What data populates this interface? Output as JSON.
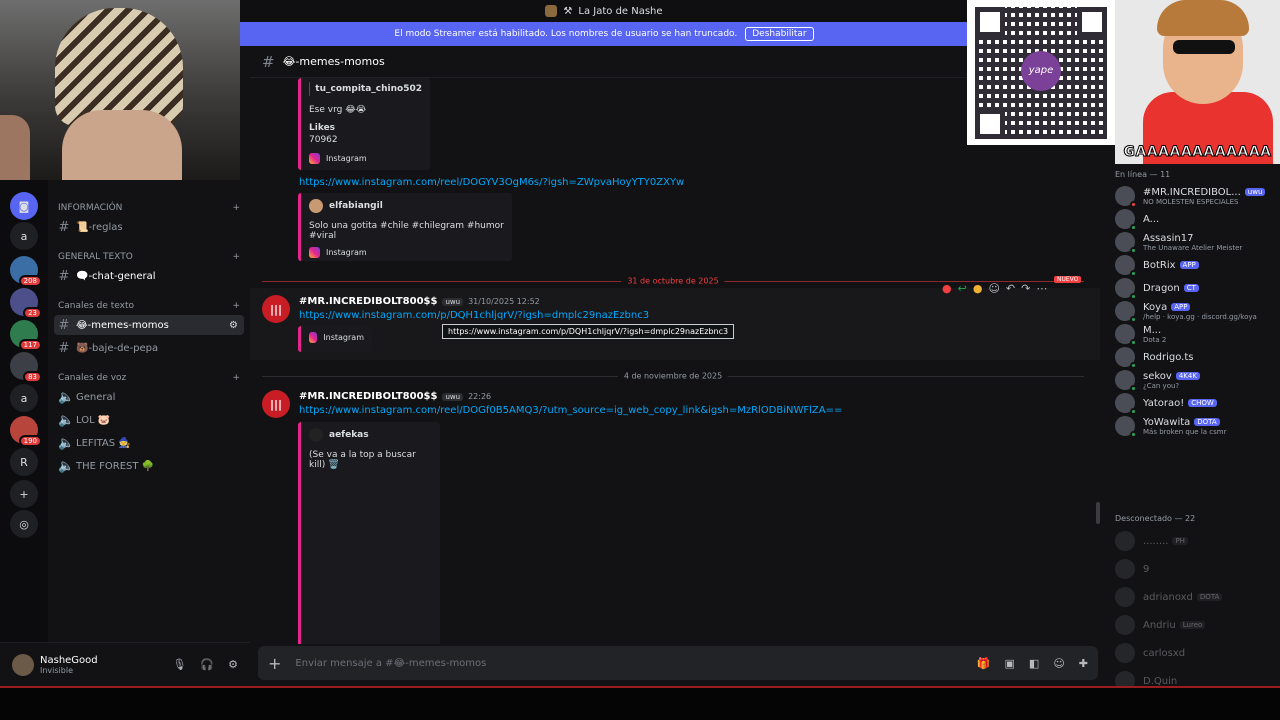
{
  "window": {
    "title": "La Jato de Nashe"
  },
  "streamer_banner": {
    "text": "El modo Streamer está habilitado. Los nombres de usuario se han truncado.",
    "button": "Deshabilitar"
  },
  "server_rail": {
    "items": [
      {
        "label": "a"
      },
      {
        "badge": "208"
      },
      {
        "badge": "23"
      },
      {
        "badge": "117"
      },
      {
        "badge": "83"
      },
      {
        "label": "a"
      },
      {
        "badge": "190"
      },
      {
        "label": "R"
      }
    ]
  },
  "channels": {
    "categories": {
      "info": "INFORMACIÓN",
      "general_text": "GENERAL TEXTO",
      "text": "Canales de texto",
      "voice": "Canales de voz"
    },
    "items": {
      "reglas": "📜-reglas",
      "chat_general": "🗨️-chat-general",
      "memes": "😂-memes-momos",
      "baje": "🐻-baje-de-pepa",
      "general_voice": "General",
      "lol": "LOL 🐷",
      "lefitas": "LEFITAS 🧙",
      "forest": "THE FOREST 🌳"
    }
  },
  "user_panel": {
    "name": "NasheGood",
    "status": "Invisible"
  },
  "chat": {
    "channel_name": "😂-memes-momos",
    "embed1": {
      "author": "tu_compita_chino502",
      "text": "Ese vrg 😂😭",
      "field_label": "Likes",
      "field_value": "70962",
      "footer": "Instagram"
    },
    "link1": "https://www.instagram.com/reel/DOGYV3OgM6s/?igsh=ZWpvaHoyYTY0ZXYw",
    "embed2": {
      "author": "elfabiangil",
      "text": "Solo una gotita #chile #chilegram #humor #viral",
      "footer": "Instagram"
    },
    "divider1": "31 de octubre de 2025",
    "new_badge": "NUEVO",
    "msg1": {
      "author": "#MR.INCREDIBOLT800$$",
      "tag": "uwu",
      "time": "31/10/2025 12:52",
      "link": "https://www.instagram.com/p/DQH1chljqrV/?igsh=dmplc29nazEzbnc3",
      "embed_footer": "Instagram"
    },
    "tooltip": "https://www.instagram.com/p/DQH1chljqrV/?igsh=dmplc29nazEzbnc3",
    "divider2": "4 de noviembre de 2025",
    "msg2": {
      "author": "#MR.INCREDIBOLT800$$",
      "tag": "uwu",
      "time": "22:26",
      "link": "https://www.instagram.com/reel/DOGf0B5AMQ3/?utm_source=ig_web_copy_link&igsh=MzRlODBiNWFlZA=="
    },
    "embed3": {
      "author": "aefekas",
      "text": "(Se va a la top a buscar kill) 🗑️"
    },
    "composer_placeholder": "Enviar mensaje a #😂-memes-momos"
  },
  "overlay": {
    "qr_brand": "yape",
    "cam_caption": "GAAAAAAAAAAAA"
  },
  "members": {
    "online_header": "En línea — 11",
    "online": [
      {
        "name": "#MR.INCREDIBOL...",
        "tag": "uwu",
        "status": "NO MOLESTEN ESPECIALES",
        "dot": "#f23f42"
      },
      {
        "name": "A...",
        "status": "",
        "dot": "#23a55a"
      },
      {
        "name": "Assasin17",
        "status": "The Unaware Atelier Meister",
        "dot": "#23a55a"
      },
      {
        "name": "BotRix",
        "tag": "APP",
        "status": "",
        "dot": "#23a55a"
      },
      {
        "name": "Dragon",
        "tag": "CT",
        "status": "",
        "dot": "#23a55a"
      },
      {
        "name": "Koya",
        "tag": "APP",
        "status": "/help · koya.gg · discord.gg/koya",
        "dot": "#23a55a"
      },
      {
        "name": "M...",
        "status": "Dota 2",
        "dot": "#23a55a"
      },
      {
        "name": "Rodrigo.ts",
        "status": "",
        "dot": "#23a55a"
      },
      {
        "name": "sekov",
        "tag": "4K4K",
        "status": "¿Can you?",
        "dot": "#23a55a"
      },
      {
        "name": "Yatorao!",
        "tag": "CHOW",
        "status": "",
        "dot": "#23a55a"
      },
      {
        "name": "YoWawita",
        "tag": "DOTA",
        "status": "Más broken que la csmr",
        "dot": "#23a55a"
      }
    ],
    "offline_header": "Desconectado — 22",
    "offline": [
      {
        "name": "........",
        "tag": "PH"
      },
      {
        "name": "9"
      },
      {
        "name": "adrianoxd",
        "tag": "DOTA"
      },
      {
        "name": "Andriu",
        "tag": "Lureo"
      },
      {
        "name": "carlosxd"
      },
      {
        "name": "D.Quin"
      }
    ]
  }
}
